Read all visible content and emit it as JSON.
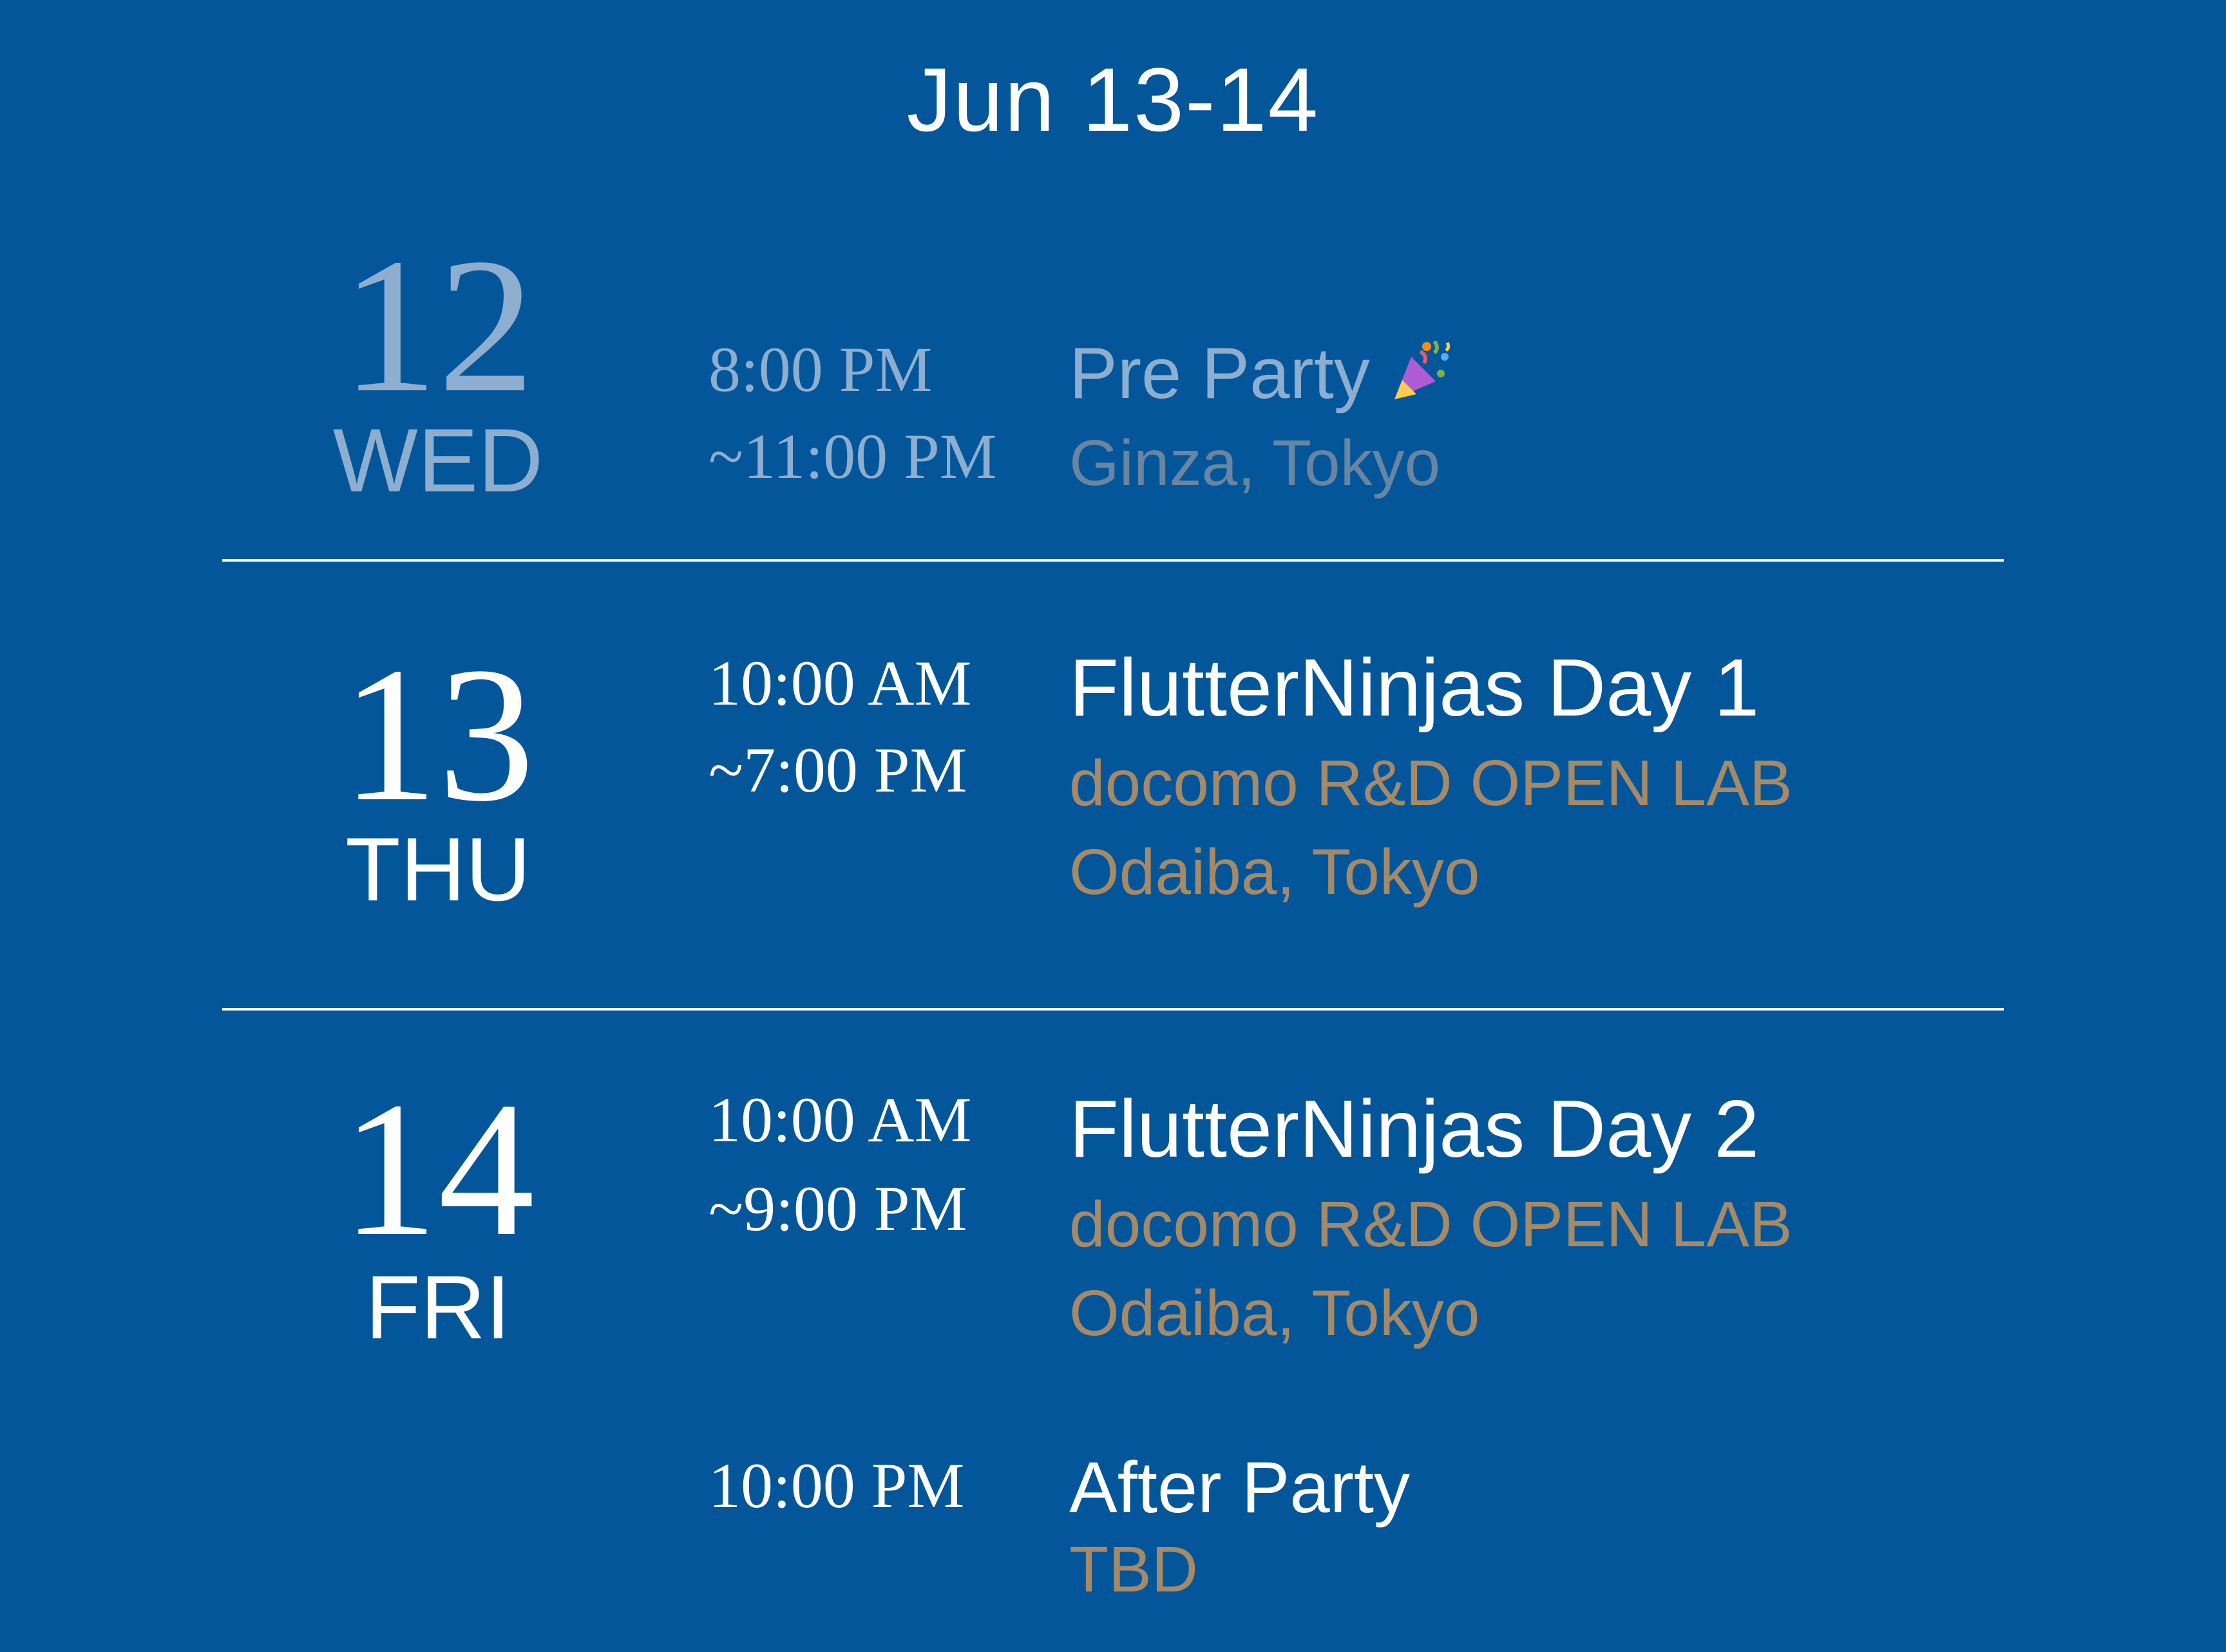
{
  "header": {
    "title": "Jun 13-14"
  },
  "days": [
    {
      "number": "12",
      "weekday": "WED",
      "state": "past",
      "events": [
        {
          "time_start": "8:00 PM",
          "time_end": "~11:00 PM",
          "title": "Pre Party",
          "icon": "party-popper-icon",
          "location": [
            "Ginza, Tokyo"
          ]
        }
      ]
    },
    {
      "number": "13",
      "weekday": "THU",
      "state": "active",
      "events": [
        {
          "time_start": "10:00 AM",
          "time_end": "~7:00 PM",
          "title": "FlutterNinjas Day 1",
          "location": [
            "docomo R&D OPEN LAB",
            "Odaiba, Tokyo"
          ]
        }
      ]
    },
    {
      "number": "14",
      "weekday": "FRI",
      "state": "active",
      "events": [
        {
          "time_start": "10:00 AM",
          "time_end": "~9:00 PM",
          "title": "FlutterNinjas Day 2",
          "location": [
            "docomo R&D OPEN LAB",
            "Odaiba, Tokyo"
          ]
        },
        {
          "time_start": "10:00 PM",
          "title": "After Party",
          "location": [
            "TBD"
          ]
        }
      ]
    }
  ],
  "colors": {
    "background": "#03569a",
    "text": "#ffffff",
    "location": "#a68a67",
    "muted_text": "#8eaed0",
    "muted_location": "#6a85a1"
  }
}
